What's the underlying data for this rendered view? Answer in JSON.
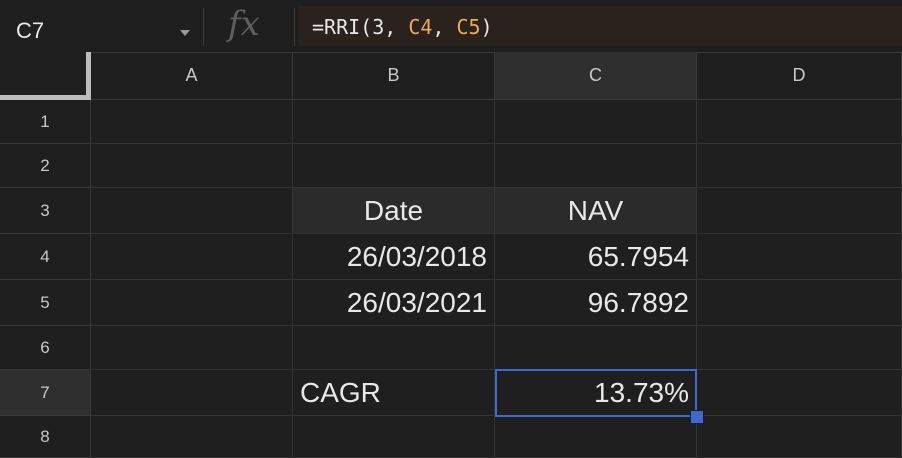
{
  "name_box": {
    "value": "C7"
  },
  "formula_bar": {
    "fx_label": "fx",
    "formula_prefix": "=RRI(3, ",
    "ref1": "C4",
    "comma": ", ",
    "ref2": "C5",
    "suffix": ")"
  },
  "columns": [
    "A",
    "B",
    "C",
    "D"
  ],
  "rows": [
    "1",
    "2",
    "3",
    "4",
    "5",
    "6",
    "7",
    "8"
  ],
  "cells": {
    "B3": "Date",
    "C3": "NAV",
    "B4": "26/03/2018",
    "C4": "65.7954",
    "B5": "26/03/2021",
    "C5": "96.7892",
    "B7": "CAGR",
    "C7": "13.73%"
  },
  "selected_cell": "C7",
  "colors": {
    "background": "#1f1f1f",
    "selection": "#3c6ad0",
    "formula_ref": "#f0a95a"
  }
}
